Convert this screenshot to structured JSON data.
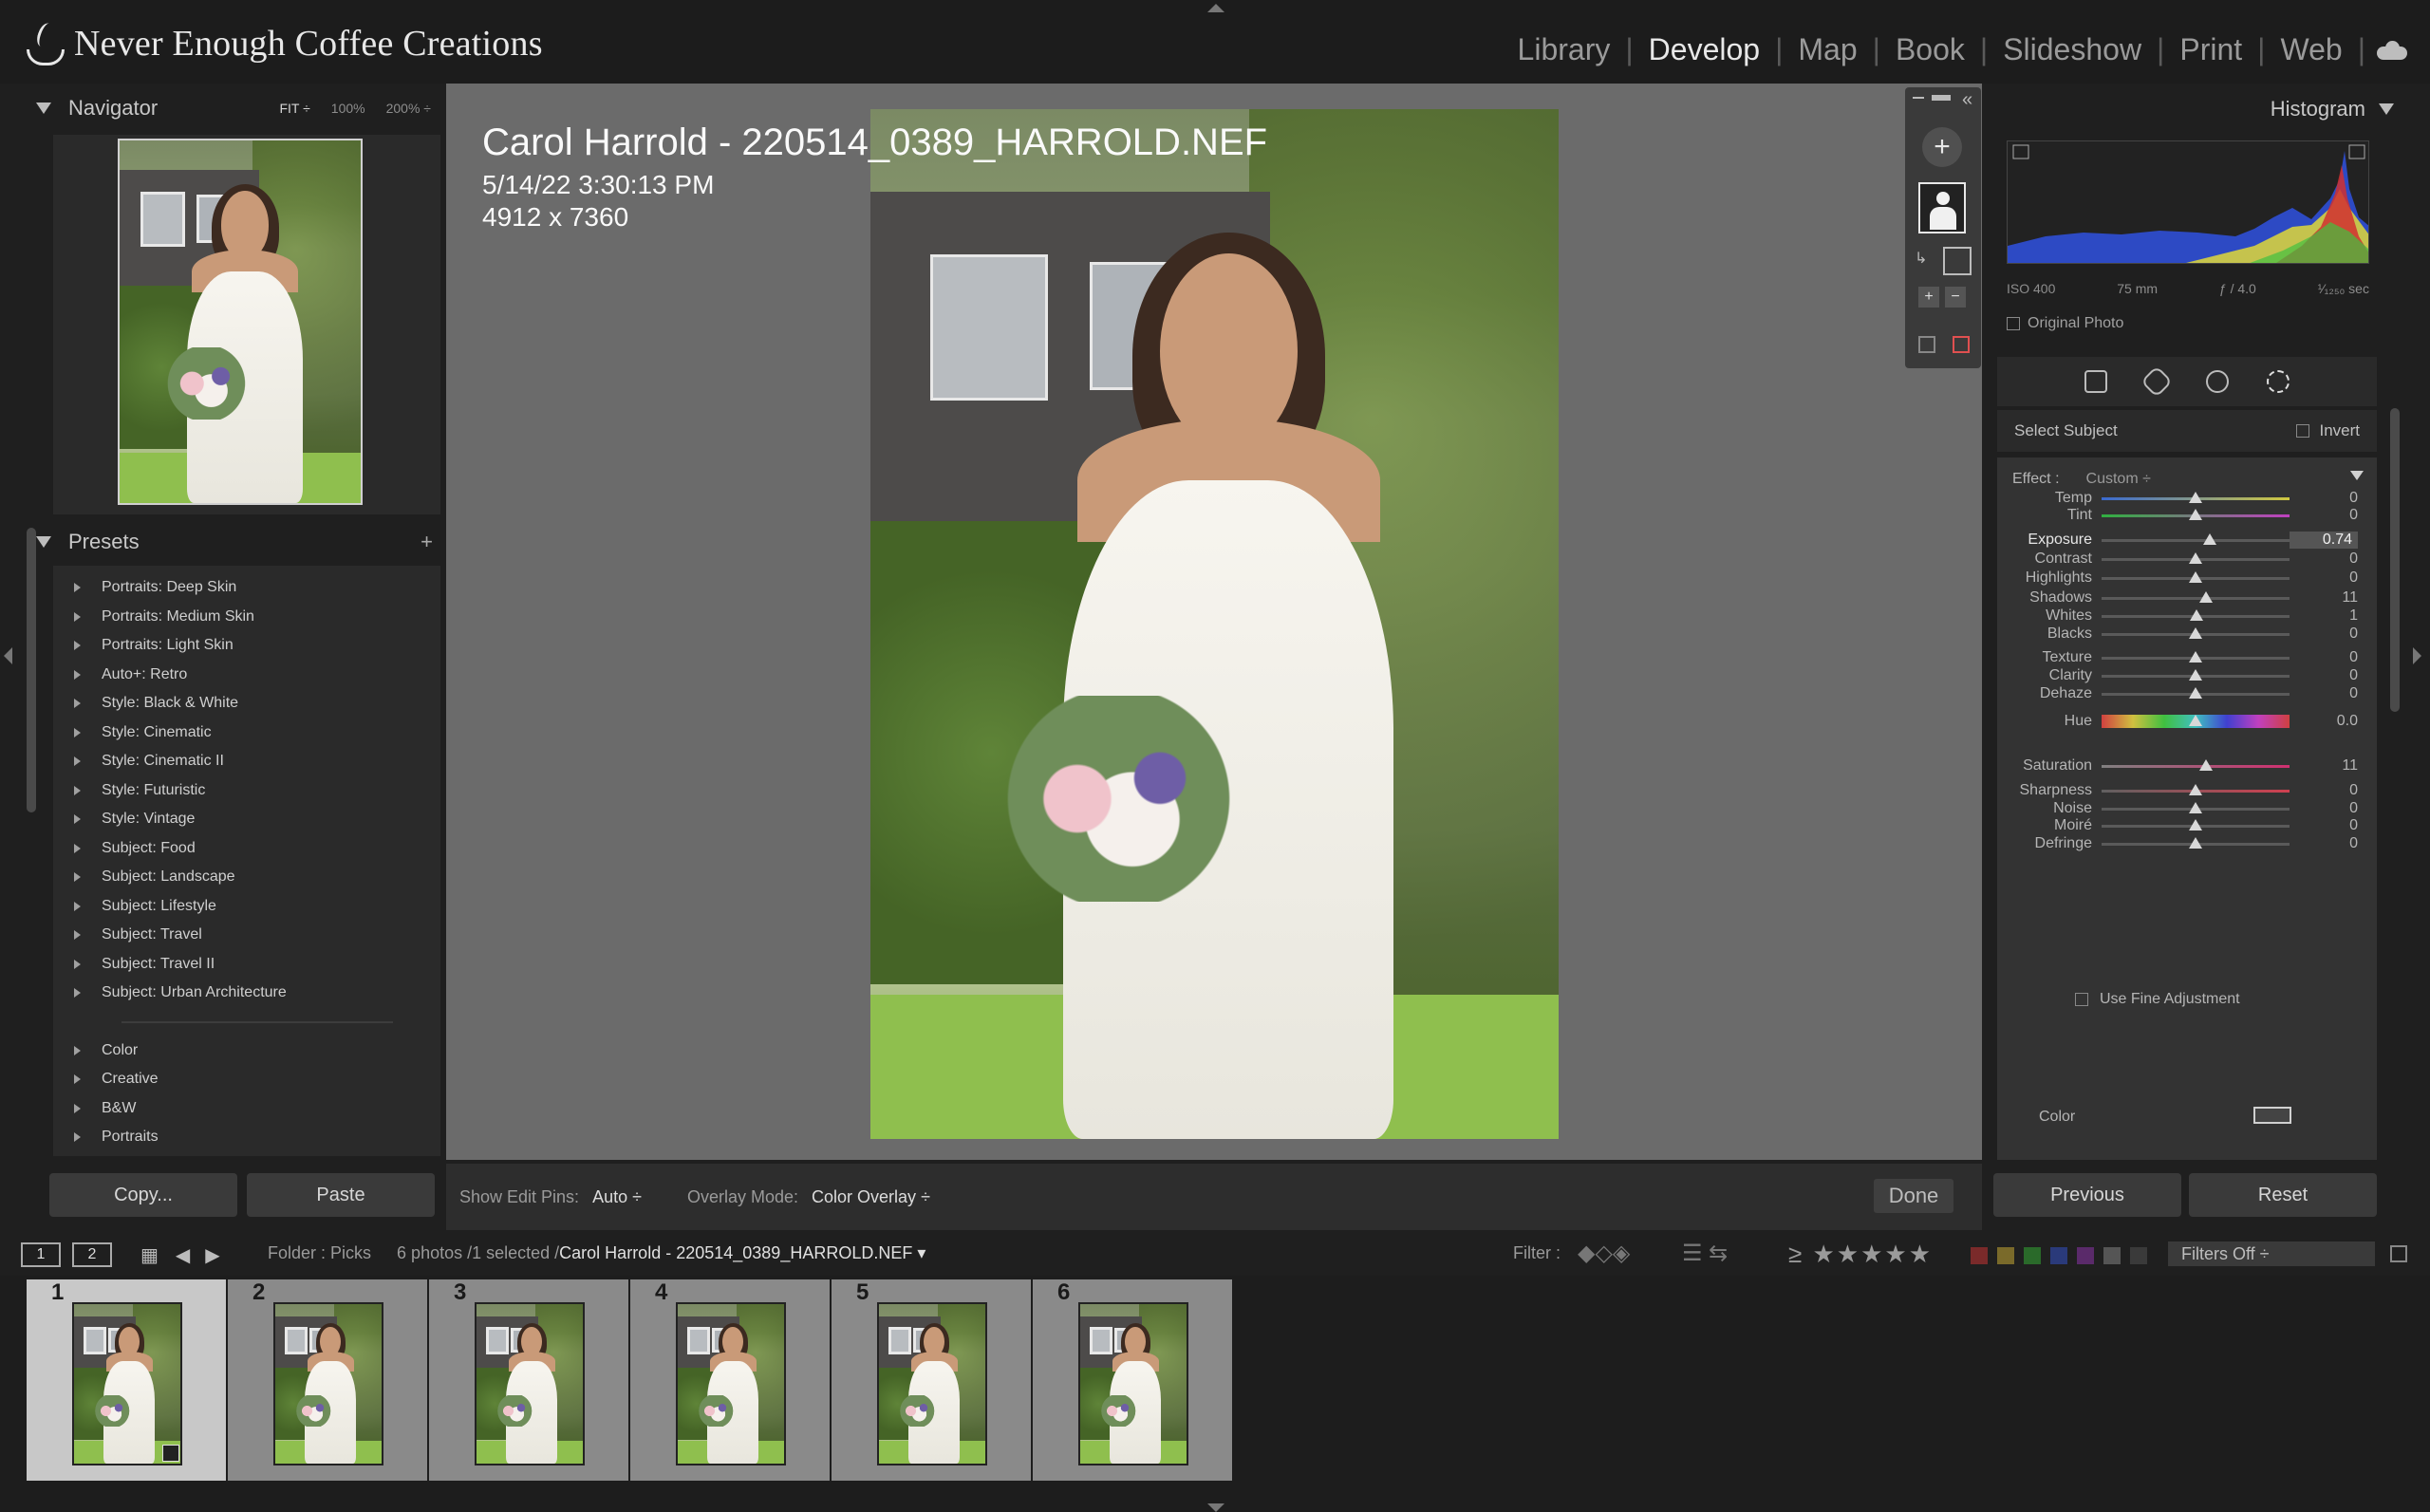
{
  "brand": {
    "name": "Never Enough Coffee Creations"
  },
  "modules": [
    {
      "label": "Library",
      "active": false
    },
    {
      "label": "Develop",
      "active": true
    },
    {
      "label": "Map",
      "active": false
    },
    {
      "label": "Book",
      "active": false
    },
    {
      "label": "Slideshow",
      "active": false
    },
    {
      "label": "Print",
      "active": false
    },
    {
      "label": "Web",
      "active": false
    }
  ],
  "navigator": {
    "title": "Navigator",
    "zoom_fit": "FIT ÷",
    "zoom_100": "100%",
    "zoom_200": "200% ÷"
  },
  "presets": {
    "title": "Presets",
    "items": [
      "Portraits: Deep Skin",
      "Portraits: Medium Skin",
      "Portraits: Light Skin",
      "Auto+: Retro",
      "Style: Black & White",
      "Style: Cinematic",
      "Style: Cinematic II",
      "Style: Futuristic",
      "Style: Vintage",
      "Subject: Food",
      "Subject: Landscape",
      "Subject: Lifestyle",
      "Subject: Travel",
      "Subject: Travel II",
      "Subject: Urban Architecture"
    ],
    "groups": [
      "Color",
      "Creative",
      "B&W",
      "Portraits"
    ]
  },
  "left_buttons": {
    "copy": "Copy...",
    "paste": "Paste"
  },
  "photo_info": {
    "title": "Carol Harrold - 220514_0389_HARROLD.NEF",
    "date": "5/14/22 3:30:13 PM",
    "dimensions": "4912 x 7360"
  },
  "toolbar": {
    "edit_pins_label": "Show Edit Pins:",
    "edit_pins_value": "Auto ÷",
    "overlay_label": "Overlay Mode:",
    "overlay_value": "Color Overlay ÷",
    "done": "Done"
  },
  "histogram": {
    "title": "Histogram",
    "iso": "ISO 400",
    "focal": "75 mm",
    "aperture": "ƒ / 4.0",
    "shutter": "¹⁄₁₂₅₀ sec",
    "original_photo": "Original Photo"
  },
  "mask": {
    "select_subject": "Select Subject",
    "invert": "Invert"
  },
  "effect": {
    "label": "Effect :",
    "value": "Custom ÷"
  },
  "sliders": [
    {
      "label": "Temp",
      "value": "0",
      "pos": 0.5
    },
    {
      "label": "Tint",
      "value": "0",
      "pos": 0.5
    },
    {
      "label": "Exposure",
      "value": "0.74",
      "pos": 0.574
    },
    {
      "label": "Contrast",
      "value": "0",
      "pos": 0.5
    },
    {
      "label": "Highlights",
      "value": "0",
      "pos": 0.5
    },
    {
      "label": "Shadows",
      "value": "11",
      "pos": 0.555
    },
    {
      "label": "Whites",
      "value": "1",
      "pos": 0.505
    },
    {
      "label": "Blacks",
      "value": "0",
      "pos": 0.5
    },
    {
      "label": "Texture",
      "value": "0",
      "pos": 0.5
    },
    {
      "label": "Clarity",
      "value": "0",
      "pos": 0.5
    },
    {
      "label": "Dehaze",
      "value": "0",
      "pos": 0.5
    },
    {
      "label": "Hue",
      "value": "0.0",
      "pos": 0.5
    },
    {
      "label": "Saturation",
      "value": "11",
      "pos": 0.555
    },
    {
      "label": "Sharpness",
      "value": "0",
      "pos": 0.5
    },
    {
      "label": "Noise",
      "value": "0",
      "pos": 0.5
    },
    {
      "label": "Moiré",
      "value": "0",
      "pos": 0.5
    },
    {
      "label": "Defringe",
      "value": "0",
      "pos": 0.5
    }
  ],
  "fine_adjust": "Use Fine Adjustment",
  "color_label": "Color",
  "right_buttons": {
    "previous": "Previous",
    "reset": "Reset"
  },
  "filmstrip_bar": {
    "screen1": "1",
    "screen2": "2",
    "folder": "Folder : Picks",
    "count": "6 photos /1 selected /",
    "file": "Carol Harrold - 220514_0389_HARROLD.NEF ▾",
    "filter": "Filter :",
    "stars": "≥ ★★★★★",
    "filters_off": "Filters Off ÷"
  },
  "filmstrip": [
    "1",
    "2",
    "3",
    "4",
    "5",
    "6"
  ],
  "colors": {
    "active_module": "#e8e8e8",
    "panel": "#333333",
    "center_bg": "#6b6b6b"
  }
}
